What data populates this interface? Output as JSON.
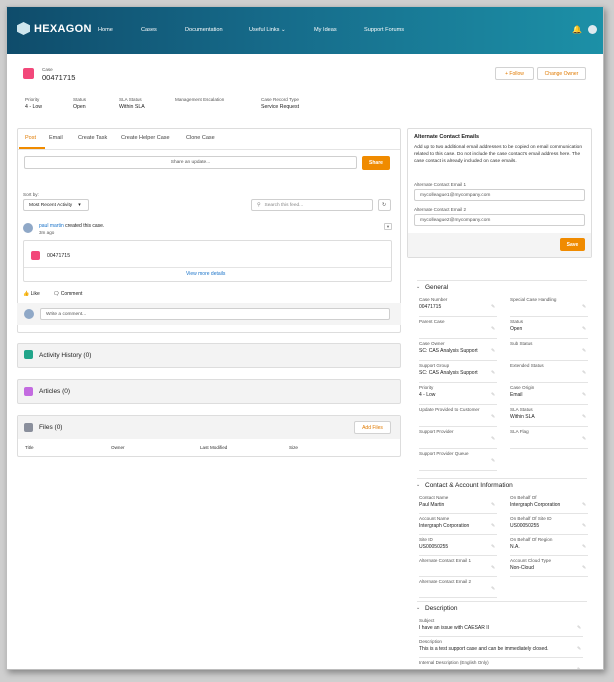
{
  "nav": {
    "logo": "HEXAGON",
    "links": [
      "Home",
      "Cases",
      "Documentation",
      "Useful Links",
      "My Ideas",
      "Support Forums"
    ]
  },
  "header": {
    "type_label": "Case",
    "case_number": "00471715",
    "follow_label": "+ Follow",
    "change_owner_label": "Change Owner",
    "fields": [
      {
        "label": "Priority",
        "value": "4 - Low"
      },
      {
        "label": "Status",
        "value": "Open"
      },
      {
        "label": "SLA Status",
        "value": "Within SLA"
      },
      {
        "label": "Management Escalation",
        "value": ""
      },
      {
        "label": "Case Record Type",
        "value": "Service Request"
      }
    ]
  },
  "feed": {
    "tabs": [
      "Post",
      "Email",
      "Create Task",
      "Create Helper Case",
      "Clone Case"
    ],
    "share_placeholder": "Share an update...",
    "share_label": "Share",
    "sort_label": "Sort by:",
    "sort_value": "Most Recent Activity",
    "search_placeholder": "Search this feed...",
    "item": {
      "author": "paul martin",
      "action": "created this case.",
      "time": "3m ago",
      "record": "00471715",
      "view_more": "View more details"
    },
    "like_label": "Like",
    "comment_label": "Comment",
    "comment_placeholder": "Write a comment..."
  },
  "related": {
    "activity": "Activity History (0)",
    "articles": "Articles (0)",
    "files": "Files (0)",
    "add_files": "Add Files",
    "files_columns": [
      "Title",
      "Owner",
      "Last Modified",
      "Size"
    ]
  },
  "alt_emails": {
    "title": "Alternate Contact Emails",
    "description": "Add up to two additional email addresses to be copied on email communication related to this case. Do not include the case contact's email address here. The case contact is already included on case emails.",
    "email1_label": "Alternate Contact Email 1",
    "email1": "mycolleague1@mycompany.com",
    "email2_label": "Alternate Contact Email 2",
    "email2": "mycolleague2@mycompany.com",
    "save_label": "Save"
  },
  "general": {
    "title": "General",
    "fields": [
      {
        "label": "Case Number",
        "value": "00471715"
      },
      {
        "label": "Special Case Handling",
        "value": ""
      },
      {
        "label": "Parent Case",
        "value": ""
      },
      {
        "label": "Status",
        "value": "Open"
      },
      {
        "label": "Case Owner",
        "value": "SC: CAS Analysis Support"
      },
      {
        "label": "Sub Status",
        "value": ""
      },
      {
        "label": "Support Group",
        "value": "SC: CAS Analysis Support"
      },
      {
        "label": "Extended Status",
        "value": ""
      },
      {
        "label": "Priority",
        "value": "4 - Low"
      },
      {
        "label": "Case Origin",
        "value": "Email"
      },
      {
        "label": "Update Provided to Customer",
        "value": ""
      },
      {
        "label": "SLA Status",
        "value": "Within SLA"
      },
      {
        "label": "Support Provider",
        "value": ""
      },
      {
        "label": "SLA Flag",
        "value": ""
      },
      {
        "label": "Support Provider Queue",
        "value": ""
      }
    ]
  },
  "contact": {
    "title": "Contact & Account Information",
    "fields": [
      {
        "label": "Contact Name",
        "value": "Paul Martin"
      },
      {
        "label": "On Behalf Of",
        "value": "Intergraph Corporation"
      },
      {
        "label": "Account Name",
        "value": "Intergraph Corporation"
      },
      {
        "label": "On Behalf Of Site ID",
        "value": "US00050255"
      },
      {
        "label": "Site ID",
        "value": "US00050255"
      },
      {
        "label": "On Behalf Of Region",
        "value": "N.A."
      },
      {
        "label": "Alternate Contact Email 1",
        "value": ""
      },
      {
        "label": "Account Cloud Type",
        "value": "Non-Cloud"
      },
      {
        "label": "Alternate Contact Email 2",
        "value": ""
      }
    ]
  },
  "description": {
    "title": "Description",
    "fields": [
      {
        "label": "Subject",
        "value": "I have an issue with CAESAR II"
      },
      {
        "label": "Description",
        "value": "This is a test support case and can be immediately closed."
      },
      {
        "label": "Internal Description (English Only)",
        "value": ""
      }
    ]
  },
  "colors": {
    "accent": "#f08b00",
    "link": "#1a73c9",
    "nav_start": "#0f4c6b",
    "nav_end": "#1c90a7"
  }
}
